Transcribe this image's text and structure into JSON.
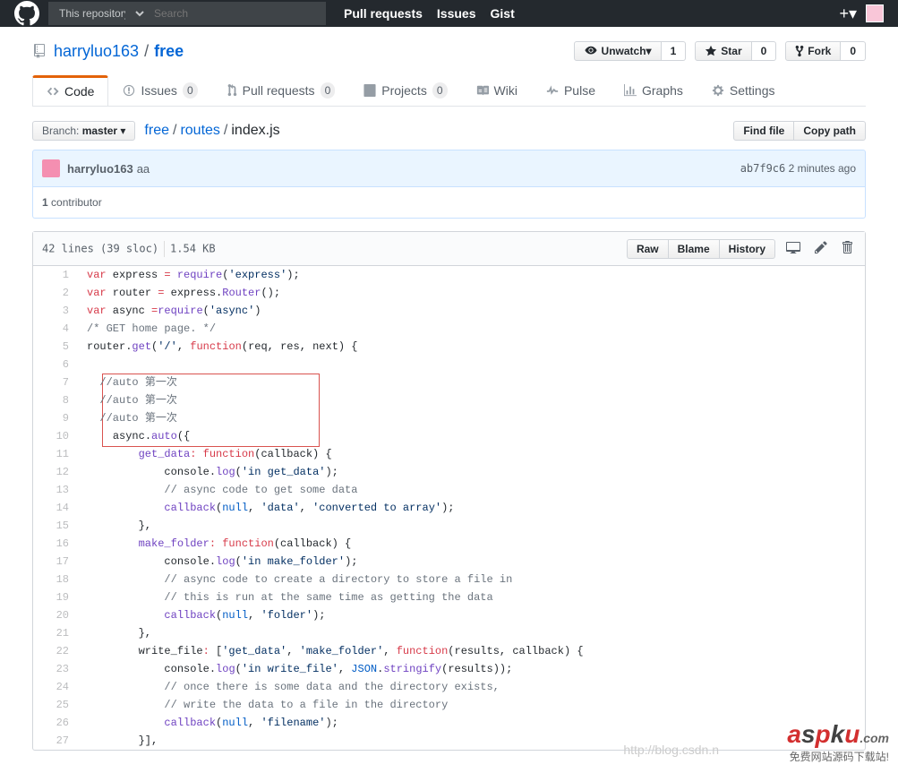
{
  "topbar": {
    "scope": "This repository",
    "search_placeholder": "Search",
    "nav": {
      "pr": "Pull requests",
      "issues": "Issues",
      "gist": "Gist"
    }
  },
  "repo": {
    "owner": "harryluo163",
    "name": "free",
    "actions": {
      "unwatch": "Unwatch",
      "unwatch_count": "1",
      "star": "Star",
      "star_count": "0",
      "fork": "Fork",
      "fork_count": "0"
    }
  },
  "tabs": {
    "code": "Code",
    "issues": "Issues",
    "issues_count": "0",
    "pr": "Pull requests",
    "pr_count": "0",
    "projects": "Projects",
    "projects_count": "0",
    "wiki": "Wiki",
    "pulse": "Pulse",
    "graphs": "Graphs",
    "settings": "Settings"
  },
  "branch": {
    "label": "Branch:",
    "name": "master"
  },
  "breadcrumb": {
    "root": "free",
    "dir": "routes",
    "file": "index.js"
  },
  "file_nav": {
    "find": "Find file",
    "copy": "Copy path"
  },
  "commit": {
    "author": "harryluo163",
    "msg": "aa",
    "sha": "ab7f9c6",
    "time": "2 minutes ago"
  },
  "contributors": {
    "count": "1",
    "label": "contributor"
  },
  "file_info": {
    "lines": "42 lines (39 sloc)",
    "size": "1.54 KB"
  },
  "file_actions": {
    "raw": "Raw",
    "blame": "Blame",
    "history": "History"
  },
  "code": [
    {
      "n": 1,
      "h": "<span class='pl-k'>var</span> express <span class='pl-k'>=</span> <span class='pl-en'>require</span>(<span class='pl-s'>'express'</span>);"
    },
    {
      "n": 2,
      "h": "<span class='pl-k'>var</span> router <span class='pl-k'>=</span> <span class='pl-smi'>express</span>.<span class='pl-en'>Router</span>();"
    },
    {
      "n": 3,
      "h": "<span class='pl-k'>var</span> async <span class='pl-k'>=</span><span class='pl-en'>require</span>(<span class='pl-s'>'async'</span>)"
    },
    {
      "n": 4,
      "h": "<span class='pl-c'>/* GET home page. */</span>"
    },
    {
      "n": 5,
      "h": "<span class='pl-smi'>router</span>.<span class='pl-en'>get</span>(<span class='pl-s'>'/'</span>, <span class='pl-k'>function</span>(<span class='pl-smi'>req</span>, <span class='pl-smi'>res</span>, <span class='pl-smi'>next</span>) {"
    },
    {
      "n": 6,
      "h": ""
    },
    {
      "n": 7,
      "h": "  <span class='pl-c'>//auto 第一次</span>"
    },
    {
      "n": 8,
      "h": "  <span class='pl-c'>//auto 第一次</span>"
    },
    {
      "n": 9,
      "h": "  <span class='pl-c'>//auto 第一次</span>"
    },
    {
      "n": 10,
      "h": "    <span class='pl-smi'>async</span>.<span class='pl-en'>auto</span>({"
    },
    {
      "n": 11,
      "h": "        <span class='pl-en'>get_data</span><span class='pl-k'>:</span> <span class='pl-k'>function</span>(<span class='pl-smi'>callback</span>) {"
    },
    {
      "n": 12,
      "h": "            <span class='pl-smi'>console</span>.<span class='pl-en'>log</span>(<span class='pl-s'>'in get_data'</span>);"
    },
    {
      "n": 13,
      "h": "            <span class='pl-c'>// async code to get some data</span>"
    },
    {
      "n": 14,
      "h": "            <span class='pl-en'>callback</span>(<span class='pl-c1'>null</span>, <span class='pl-s'>'data'</span>, <span class='pl-s'>'converted to array'</span>);"
    },
    {
      "n": 15,
      "h": "        },"
    },
    {
      "n": 16,
      "h": "        <span class='pl-en'>make_folder</span><span class='pl-k'>:</span> <span class='pl-k'>function</span>(<span class='pl-smi'>callback</span>) {"
    },
    {
      "n": 17,
      "h": "            <span class='pl-smi'>console</span>.<span class='pl-en'>log</span>(<span class='pl-s'>'in make_folder'</span>);"
    },
    {
      "n": 18,
      "h": "            <span class='pl-c'>// async code to create a directory to store a file in</span>"
    },
    {
      "n": 19,
      "h": "            <span class='pl-c'>// this is run at the same time as getting the data</span>"
    },
    {
      "n": 20,
      "h": "            <span class='pl-en'>callback</span>(<span class='pl-c1'>null</span>, <span class='pl-s'>'folder'</span>);"
    },
    {
      "n": 21,
      "h": "        },"
    },
    {
      "n": 22,
      "h": "        write_file<span class='pl-k'>:</span> [<span class='pl-s'>'get_data'</span>, <span class='pl-s'>'make_folder'</span>, <span class='pl-k'>function</span>(<span class='pl-smi'>results</span>, <span class='pl-smi'>callback</span>) {"
    },
    {
      "n": 23,
      "h": "            <span class='pl-smi'>console</span>.<span class='pl-en'>log</span>(<span class='pl-s'>'in write_file'</span>, <span class='pl-c1'>JSON</span>.<span class='pl-en'>stringify</span>(results));"
    },
    {
      "n": 24,
      "h": "            <span class='pl-c'>// once there is some data and the directory exists,</span>"
    },
    {
      "n": 25,
      "h": "            <span class='pl-c'>// write the data to a file in the directory</span>"
    },
    {
      "n": 26,
      "h": "            <span class='pl-en'>callback</span>(<span class='pl-c1'>null</span>, <span class='pl-s'>'filename'</span>);"
    },
    {
      "n": 27,
      "h": "        }],"
    }
  ],
  "watermark": {
    "url": "http://blog.csdn.n",
    "text": "aspku",
    "dom": ".com",
    "sub": "免费网站源码下载站!"
  }
}
